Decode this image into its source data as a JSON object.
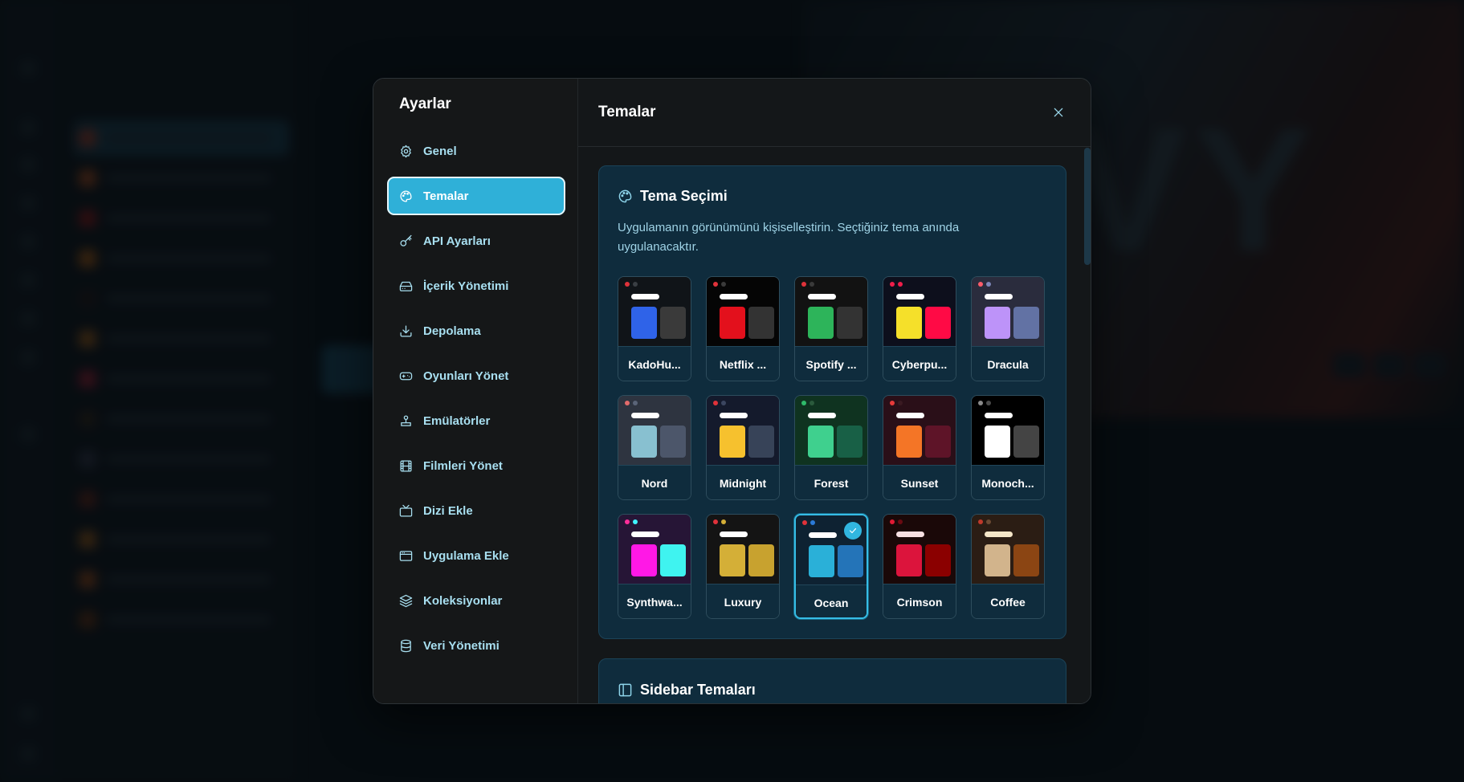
{
  "settings": {
    "title": "Ayarlar",
    "nav": [
      {
        "key": "genel",
        "label": "Genel",
        "icon": "gear-icon"
      },
      {
        "key": "temalar",
        "label": "Temalar",
        "icon": "palette-icon",
        "active": true
      },
      {
        "key": "api",
        "label": "API Ayarları",
        "icon": "key-icon"
      },
      {
        "key": "icerik",
        "label": "İçerik Yönetimi",
        "icon": "drive-icon"
      },
      {
        "key": "depolama",
        "label": "Depolama",
        "icon": "download-icon"
      },
      {
        "key": "oyunlar",
        "label": "Oyunları Yönet",
        "icon": "gamepad-icon"
      },
      {
        "key": "emulatorler",
        "label": "Emülatörler",
        "icon": "joystick-icon"
      },
      {
        "key": "filmler",
        "label": "Filmleri Yönet",
        "icon": "film-icon"
      },
      {
        "key": "dizi",
        "label": "Dizi Ekle",
        "icon": "tv-icon"
      },
      {
        "key": "uygulama",
        "label": "Uygulama Ekle",
        "icon": "app-window-icon"
      },
      {
        "key": "koleksiyonlar",
        "label": "Koleksiyonlar",
        "icon": "layers-icon"
      },
      {
        "key": "veri",
        "label": "Veri Yönetimi",
        "icon": "database-icon"
      }
    ]
  },
  "main": {
    "title": "Temalar",
    "theme_section": {
      "title": "Tema Seçimi",
      "description": "Uygulamanın görünümünü kişiselleştirin. Seçtiğiniz tema anında uygulanacaktır.",
      "themes": [
        {
          "label": "KadoHu...",
          "bg": "#101418",
          "dot1": "#e0323a",
          "dot2": "#3a3f44",
          "bar": "#ffffff",
          "sw1": "#2f63e8",
          "sw2": "#3a3a3a"
        },
        {
          "label": "Netflix ...",
          "bg": "#050505",
          "dot1": "#e0323a",
          "dot2": "#3a3a3a",
          "bar": "#ffffff",
          "sw1": "#e3101c",
          "sw2": "#333333"
        },
        {
          "label": "Spotify ...",
          "bg": "#121212",
          "dot1": "#e0323a",
          "dot2": "#3a3a3a",
          "bar": "#ffffff",
          "sw1": "#2db45a",
          "sw2": "#333333"
        },
        {
          "label": "Cyberpu...",
          "bg": "#0d0f1c",
          "dot1": "#f01e4a",
          "dot2": "#f01e4a",
          "bar": "#ffffff",
          "sw1": "#f5e02a",
          "sw2": "#ff0a45"
        },
        {
          "label": "Dracula",
          "bg": "#2a2c3d",
          "dot1": "#ff5c6a",
          "dot2": "#7c86b8",
          "bar": "#ffffff",
          "sw1": "#bd93f9",
          "sw2": "#6272a4"
        },
        {
          "label": "Nord",
          "bg": "#2e3440",
          "dot1": "#e36b6b",
          "dot2": "#5a6478",
          "bar": "#ffffff",
          "sw1": "#88c0d0",
          "sw2": "#4c566a"
        },
        {
          "label": "Midnight",
          "bg": "#141a2c",
          "dot1": "#e0323a",
          "dot2": "#3b4660",
          "bar": "#ffffff",
          "sw1": "#f6c12e",
          "sw2": "#374358"
        },
        {
          "label": "Forest",
          "bg": "#0f3320",
          "dot1": "#2fba6a",
          "dot2": "#2a5a3c",
          "bar": "#ffffff",
          "sw1": "#3fd08e",
          "sw2": "#186046"
        },
        {
          "label": "Sunset",
          "bg": "#2a0f18",
          "dot1": "#e83a3a",
          "dot2": "#3a1a22",
          "bar": "#ffffff",
          "sw1": "#f47526",
          "sw2": "#5e1428"
        },
        {
          "label": "Monoch...",
          "bg": "#000000",
          "dot1": "#8a8a8a",
          "dot2": "#4a4a4a",
          "bar": "#ffffff",
          "sw1": "#ffffff",
          "sw2": "#444444"
        },
        {
          "label": "Synthwa...",
          "bg": "#261536",
          "dot1": "#ff2e9a",
          "dot2": "#3ff3ff",
          "bar": "#ffffff",
          "sw1": "#ff18e6",
          "sw2": "#3ff3f0"
        },
        {
          "label": "Luxury",
          "bg": "#141414",
          "dot1": "#e0323a",
          "dot2": "#d4af37",
          "bar": "#ffffff",
          "sw1": "#d4af37",
          "sw2": "#c8a22f"
        },
        {
          "label": "Ocean",
          "bg": "#0e2232",
          "dot1": "#e0323a",
          "dot2": "#2b7bd8",
          "bar": "#ffffff",
          "sw1": "#2ab0d8",
          "sw2": "#2474b8",
          "selected": true
        },
        {
          "label": "Crimson",
          "bg": "#1a0808",
          "dot1": "#e01a34",
          "dot2": "#6a0a12",
          "bar": "#f7dfe2",
          "sw1": "#dc143c",
          "sw2": "#8b0000"
        },
        {
          "label": "Coffee",
          "bg": "#2b1d14",
          "dot1": "#c0392b",
          "dot2": "#6b4a33",
          "bar": "#f5e6c8",
          "sw1": "#d2b48c",
          "sw2": "#8b4513"
        }
      ]
    },
    "sidebar_section": {
      "title": "Sidebar Temaları"
    }
  }
}
